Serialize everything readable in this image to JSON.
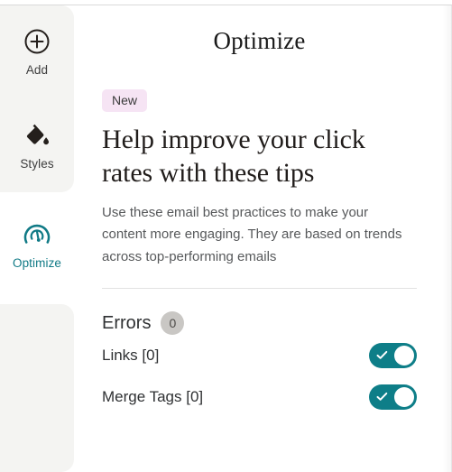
{
  "sidebar": {
    "items": [
      {
        "id": "add",
        "label": "Add",
        "icon": "plus-circle-icon",
        "active": false
      },
      {
        "id": "styles",
        "label": "Styles",
        "icon": "paint-bucket-icon",
        "active": false
      },
      {
        "id": "optimize",
        "label": "Optimize",
        "icon": "gauge-icon",
        "active": true
      }
    ]
  },
  "panel": {
    "title": "Optimize",
    "badge": "New",
    "headline": "Help improve your click rates with these tips",
    "subtext": "Use these email best practices to make your content more engaging. They are based on trends across top-performing emails"
  },
  "errors_section": {
    "title": "Errors",
    "count": "0",
    "rows": [
      {
        "label": "Links [0]",
        "toggle_on": true,
        "toggle_icon": "check-icon"
      },
      {
        "label": "Merge Tags [0]",
        "toggle_on": true,
        "toggle_icon": "check-icon"
      }
    ]
  },
  "colors": {
    "accent_teal": "#0e7e88",
    "badge_pink": "#f6e4f4",
    "sidebar_gray": "#f4f4f2",
    "count_badge_gray": "#c9c7c4",
    "divider": "#e2e2e2",
    "heading_text": "#211d1b",
    "body_text": "#57595b"
  }
}
